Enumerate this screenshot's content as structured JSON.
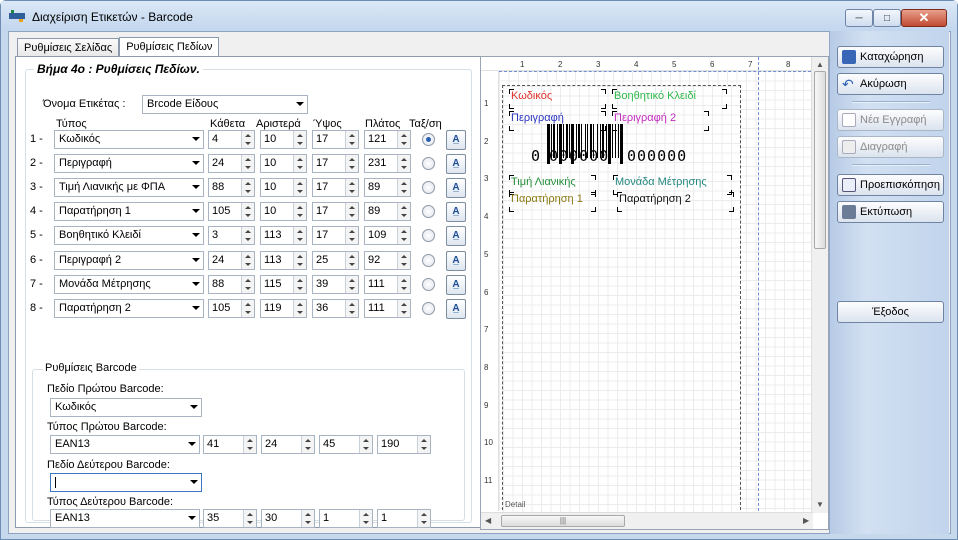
{
  "window": {
    "title": "Διαχείριση Ετικετών - Barcode"
  },
  "tabs": [
    "Ρυθμίσεις Σελίδας",
    "Ρυθμίσεις Πεδίων"
  ],
  "step_title": "Βήμα 4ο : Ρυθμίσεις Πεδίων.",
  "label_name": {
    "caption": "Όνομα Ετικέτας :",
    "value": "Brcode Είδους"
  },
  "headers": {
    "type": "Τύπος",
    "vertical": "Κάθετα",
    "left": "Αριστερά",
    "height": "Ύψος",
    "width": "Πλάτος",
    "sort": "Ταξ/ση"
  },
  "fields": [
    {
      "num": "1 -",
      "type": "Κωδικός",
      "vertical": "4",
      "left": "10",
      "height": "17",
      "width": "121",
      "selected": true
    },
    {
      "num": "2 -",
      "type": "Περιγραφή",
      "vertical": "24",
      "left": "10",
      "height": "17",
      "width": "231",
      "selected": false
    },
    {
      "num": "3 -",
      "type": "Τιμή Λιανικής με ΦΠΑ",
      "vertical": "88",
      "left": "10",
      "height": "17",
      "width": "89",
      "selected": false
    },
    {
      "num": "4 -",
      "type": "Παρατήρηση 1",
      "vertical": "105",
      "left": "10",
      "height": "17",
      "width": "89",
      "selected": false
    },
    {
      "num": "5 -",
      "type": "Βοηθητικό Κλειδί",
      "vertical": "3",
      "left": "113",
      "height": "17",
      "width": "109",
      "selected": false
    },
    {
      "num": "6 -",
      "type": "Περιγραφή 2",
      "vertical": "24",
      "left": "113",
      "height": "25",
      "width": "92",
      "selected": false
    },
    {
      "num": "7 -",
      "type": "Μονάδα Μέτρησης",
      "vertical": "88",
      "left": "115",
      "height": "39",
      "width": "111",
      "selected": false
    },
    {
      "num": "8 -",
      "type": "Παρατήρηση 2",
      "vertical": "105",
      "left": "119",
      "height": "36",
      "width": "111",
      "selected": false
    }
  ],
  "barcode": {
    "group_title": "Ρυθμίσεις Barcode",
    "first_field_caption": "Πεδίο Πρώτου Barcode:",
    "first_field_value": "Κωδικός",
    "first_type_caption": "Τύπος Πρώτου Barcode:",
    "first_type_value": "EAN13",
    "first_nums": [
      "41",
      "24",
      "45",
      "190"
    ],
    "second_field_caption": "Πεδίο Δεύτερου Barcode:",
    "second_field_value": "",
    "second_type_caption": "Τύπος Δεύτερου Barcode:",
    "second_type_value": "EAN13",
    "second_nums": [
      "35",
      "30",
      "1",
      "1"
    ]
  },
  "designer": {
    "ruler_top": [
      "1",
      "2",
      "3",
      "4",
      "5",
      "6",
      "7",
      "8"
    ],
    "ruler_left": [
      "1",
      "2",
      "3",
      "4",
      "5",
      "6",
      "7",
      "8",
      "9",
      "10",
      "11"
    ],
    "labels": {
      "kodikos": "Κωδικός",
      "voithitiko": "Βοηθητικό Κλειδί",
      "perigrafi": "Περιγραφή",
      "perigrafi2": "Περιγραφή 2",
      "timi": "Τιμή Λιανικής",
      "monada": "Μονάδα Μέτρησης",
      "paratirisi1": "Παρατήρηση 1",
      "paratirisi2": "Παρατήρηση 2"
    },
    "barcode_digits_left": "0",
    "barcode_digits_mid": "000000",
    "barcode_digits_right": "000000",
    "band_label": "Detail",
    "colors": {
      "kodikos": "#e0302a",
      "voithitiko": "#2fb84a",
      "perigrafi": "#2b35c0",
      "perigrafi2": "#c42bc0",
      "timi": "#238f3a",
      "monada": "#22877f",
      "paratirisi1": "#8c7a12",
      "paratirisi2": "#111111"
    }
  },
  "side_buttons": {
    "save": "Καταχώρηση",
    "cancel": "Ακύρωση",
    "new": "Νέα Εγγραφή",
    "delete": "Διαγραφή",
    "preview": "Προεπισκόπηση",
    "print": "Εκτύπωση",
    "exit": "Έξοδος"
  }
}
